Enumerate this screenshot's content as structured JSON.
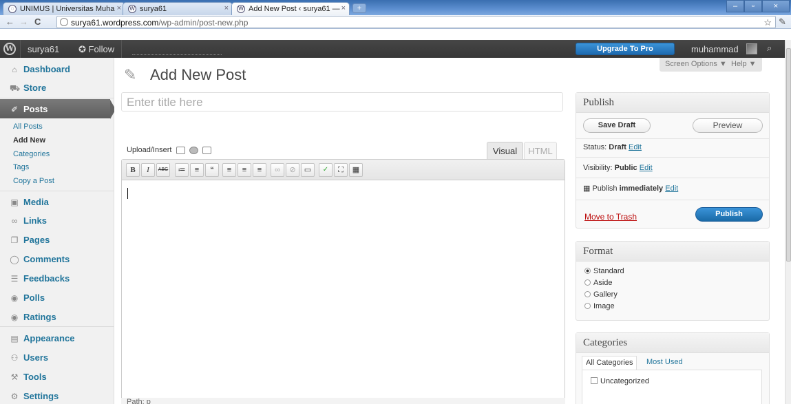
{
  "browser": {
    "tabs": [
      {
        "label": "UNIMUS | Universitas Muha"
      },
      {
        "label": "surya61"
      },
      {
        "label": "Add New Post ‹ surya61 — "
      }
    ],
    "url_host": "surya61.wordpress.com",
    "url_path": "/wp-admin/post-new.php"
  },
  "adminbar": {
    "site": "surya61",
    "follow": "Follow",
    "upgrade": "Upgrade To Pro",
    "user": "muhammad"
  },
  "sidebar": {
    "items": [
      {
        "label": "Dashboard",
        "icon": "home-icon"
      },
      {
        "label": "Store",
        "icon": "cart-icon"
      },
      {
        "label": "Posts",
        "icon": "pin-icon"
      },
      {
        "label": "Media",
        "icon": "media-icon"
      },
      {
        "label": "Links",
        "icon": "link-icon"
      },
      {
        "label": "Pages",
        "icon": "pages-icon"
      },
      {
        "label": "Comments",
        "icon": "comment-icon"
      },
      {
        "label": "Feedbacks",
        "icon": "feedback-icon"
      },
      {
        "label": "Polls",
        "icon": "polls-icon"
      },
      {
        "label": "Ratings",
        "icon": "ratings-icon"
      },
      {
        "label": "Appearance",
        "icon": "appearance-icon"
      },
      {
        "label": "Users",
        "icon": "users-icon"
      },
      {
        "label": "Tools",
        "icon": "tools-icon"
      },
      {
        "label": "Settings",
        "icon": "settings-icon"
      }
    ],
    "posts_submenu": [
      "All Posts",
      "Add New",
      "Categories",
      "Tags",
      "Copy a Post"
    ]
  },
  "main": {
    "screen_options": "Screen Options ▼",
    "help": "Help ▼",
    "title": "Add New Post",
    "title_placeholder": "Enter title here",
    "upload_insert": "Upload/Insert",
    "tab_visual": "Visual",
    "tab_html": "HTML",
    "path_label": "Path: p"
  },
  "publish": {
    "heading": "Publish",
    "save_draft": "Save Draft",
    "preview": "Preview",
    "status_label": "Status: ",
    "status_value": "Draft",
    "visibility_label": "Visibility: ",
    "visibility_value": "Public",
    "schedule_label": "Publish ",
    "schedule_value": "immediately",
    "edit": "Edit",
    "move_to_trash": "Move to Trash",
    "publish_button": "Publish"
  },
  "format": {
    "heading": "Format",
    "options": [
      "Standard",
      "Aside",
      "Gallery",
      "Image"
    ],
    "selected": "Standard"
  },
  "categories": {
    "heading": "Categories",
    "tab_all": "All Categories",
    "tab_most": "Most Used",
    "items": [
      "Uncategorized"
    ]
  },
  "colors": {
    "link": "#21759b",
    "adminbar": "#464646",
    "publish_button": "#1e6aaf",
    "trash": "#bc0b0b"
  }
}
